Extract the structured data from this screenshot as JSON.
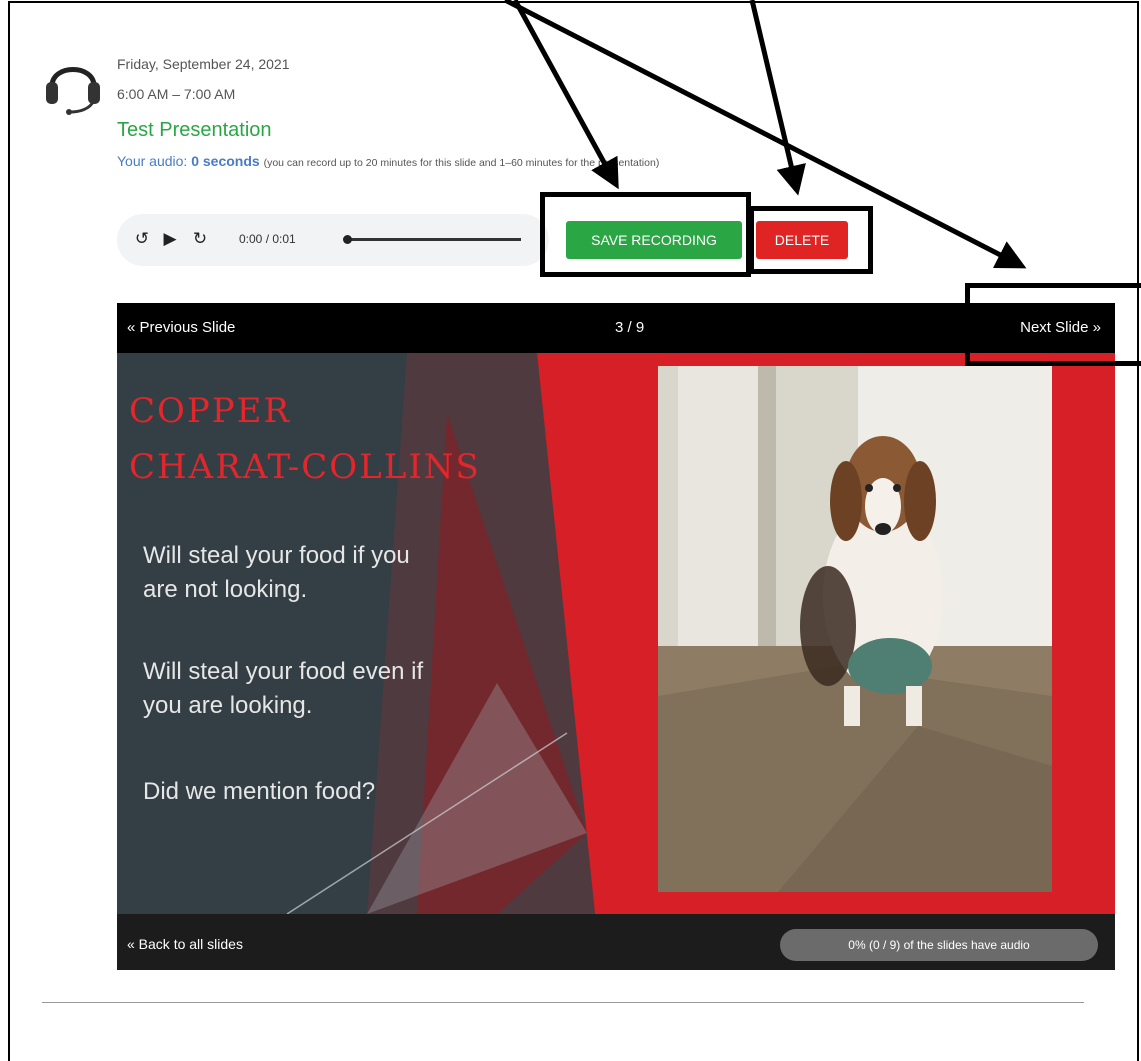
{
  "session": {
    "date": "Friday, September 24, 2021",
    "time": "6:00 AM – 7:00 AM",
    "title": "Test Presentation",
    "audio_label": "Your audio:",
    "audio_value": "0 seconds",
    "audio_note": "(you can record up to 20 minutes for this slide and 1–60 minutes for the presentation)"
  },
  "player": {
    "time": "0:00 / 0:01",
    "progress": 0
  },
  "actions": {
    "save_label": "SAVE RECORDING",
    "delete_label": "DELETE"
  },
  "viewer": {
    "prev_label": "« Previous Slide",
    "counter": "3 / 9",
    "next_label": "Next Slide »",
    "back_label": "« Back to all slides",
    "progress_text": "0% (0 / 9) of the slides have audio"
  },
  "slide": {
    "title_line1": "COPPER",
    "title_line2": "CHARAT-COLLINS",
    "bullet1_line1": "Will steal your food if you",
    "bullet1_line2": "are not looking.",
    "bullet2_line1": "Will steal your food even if",
    "bullet2_line2": "you are looking.",
    "bullet3": "Did we mention food?"
  },
  "colors": {
    "accent_green": "#2aa744",
    "danger_red": "#e02424",
    "link_blue": "#4a7bc4",
    "slide_red": "#d61f26",
    "slide_slate": "#333f45"
  }
}
